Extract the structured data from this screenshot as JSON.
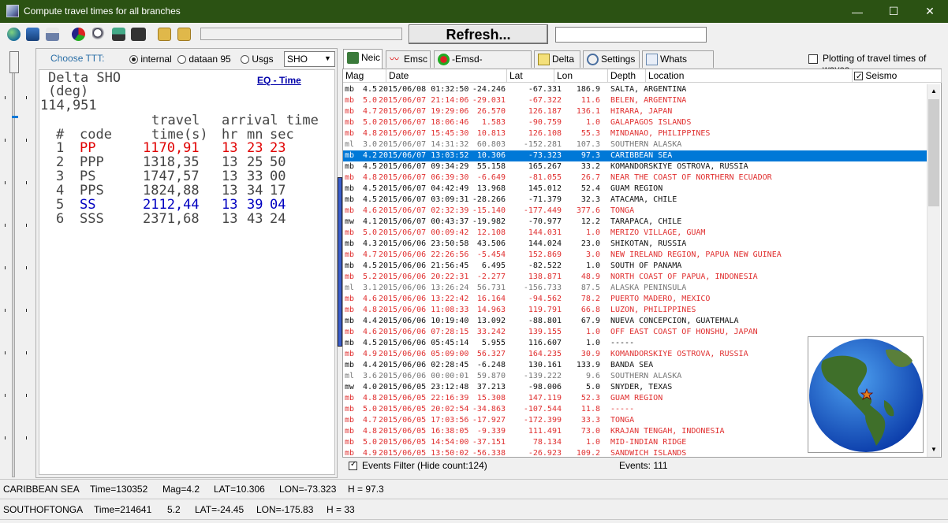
{
  "window": {
    "title": "Compute travel times for all branches",
    "min": "—",
    "max": "☐",
    "close": "✕"
  },
  "toolbar": {
    "refresh_label": "Refresh..."
  },
  "ttt_controls": {
    "choose_label": "Choose TTT:",
    "options": [
      "internal",
      "dataan 95",
      "Usgs"
    ],
    "selected": "internal",
    "station": "SHO"
  },
  "ttt": {
    "header1": "Delta SHO",
    "header2": "(deg)",
    "delta": "114,951",
    "eq_time_link": "EQ - Time",
    "col_travel": "travel",
    "col_arrival": "arrival time",
    "col_hash": "#",
    "col_code": "code",
    "col_time": "time(s)",
    "col_hr": "hr",
    "col_mn": "mn",
    "col_sec": "sec",
    "rows": [
      {
        "n": "1",
        "code": "PP",
        "time": "1170,91",
        "hr": "13",
        "mn": "23",
        "sec": "23",
        "color": "#e00000"
      },
      {
        "n": "2",
        "code": "PPP",
        "time": "1318,35",
        "hr": "13",
        "mn": "25",
        "sec": "50",
        "color": "#444444"
      },
      {
        "n": "3",
        "code": "PS",
        "time": "1747,57",
        "hr": "13",
        "mn": "33",
        "sec": "00",
        "color": "#444444"
      },
      {
        "n": "4",
        "code": "PPS",
        "time": "1824,88",
        "hr": "13",
        "mn": "34",
        "sec": "17",
        "color": "#444444"
      },
      {
        "n": "5",
        "code": "SS",
        "time": "2112,44",
        "hr": "13",
        "mn": "39",
        "sec": "04",
        "color": "#0000c0"
      },
      {
        "n": "6",
        "code": "SSS",
        "time": "2371,68",
        "hr": "13",
        "mn": "43",
        "sec": "24",
        "color": "#444444"
      }
    ]
  },
  "tabs": [
    "Neic",
    "Emsc",
    "-Emsd- Kamchatka",
    "Delta",
    "Settings",
    "Whats new..."
  ],
  "plot_option": "Plotting of travel times of waves",
  "columns": [
    "Mag",
    "Date",
    "Lat",
    "Lon",
    "Depth",
    "Location"
  ],
  "seismo_label": "Seismo",
  "events": [
    {
      "mt": "mb",
      "m": "4.5",
      "d": "2015/06/08 01:32:50",
      "lat": "-24.246",
      "lon": "-67.331",
      "dep": "186.9",
      "loc": "SALTA, ARGENTINA",
      "c": "black"
    },
    {
      "mt": "mb",
      "m": "5.0",
      "d": "2015/06/07 21:14:06",
      "lat": "-29.031",
      "lon": "-67.322",
      "dep": "11.6",
      "loc": "BELEN, ARGENTINA",
      "c": "red"
    },
    {
      "mt": "mb",
      "m": "4.7",
      "d": "2015/06/07 19:29:06",
      "lat": "26.570",
      "lon": "126.187",
      "dep": "136.1",
      "loc": "HIRARA, JAPAN",
      "c": "red"
    },
    {
      "mt": "mb",
      "m": "5.0",
      "d": "2015/06/07 18:06:46",
      "lat": "1.583",
      "lon": "-90.759",
      "dep": "1.0",
      "loc": "GALAPAGOS ISLANDS",
      "c": "red"
    },
    {
      "mt": "mb",
      "m": "4.8",
      "d": "2015/06/07 15:45:30",
      "lat": "10.813",
      "lon": "126.108",
      "dep": "55.3",
      "loc": "MINDANAO, PHILIPPINES",
      "c": "red"
    },
    {
      "mt": "ml",
      "m": "3.0",
      "d": "2015/06/07 14:31:32",
      "lat": "60.803",
      "lon": "-152.281",
      "dep": "107.3",
      "loc": "SOUTHERN ALASKA",
      "c": "gray"
    },
    {
      "mt": "mb",
      "m": "4.2",
      "d": "2015/06/07 13:03:52",
      "lat": "10.306",
      "lon": "-73.323",
      "dep": "97.3",
      "loc": "CARIBBEAN SEA",
      "c": "sel"
    },
    {
      "mt": "mb",
      "m": "4.5",
      "d": "2015/06/07 09:34:29",
      "lat": "55.158",
      "lon": "165.267",
      "dep": "33.2",
      "loc": "KOMANDORSKIYE OSTROVA, RUSSIA",
      "c": "black"
    },
    {
      "mt": "mb",
      "m": "4.8",
      "d": "2015/06/07 06:39:30",
      "lat": "-6.649",
      "lon": "-81.055",
      "dep": "26.7",
      "loc": "NEAR THE COAST OF NORTHERN ECUADOR",
      "c": "red"
    },
    {
      "mt": "mb",
      "m": "4.5",
      "d": "2015/06/07 04:42:49",
      "lat": "13.968",
      "lon": "145.012",
      "dep": "52.4",
      "loc": "GUAM REGION",
      "c": "black"
    },
    {
      "mt": "mb",
      "m": "4.5",
      "d": "2015/06/07 03:09:31",
      "lat": "-28.266",
      "lon": "-71.379",
      "dep": "32.3",
      "loc": "ATACAMA, CHILE",
      "c": "black"
    },
    {
      "mt": "mb",
      "m": "4.6",
      "d": "2015/06/07 02:32:39",
      "lat": "-15.140",
      "lon": "-177.449",
      "dep": "377.6",
      "loc": "TONGA",
      "c": "red"
    },
    {
      "mt": "mw",
      "m": "4.1",
      "d": "2015/06/07 00:43:37",
      "lat": "-19.982",
      "lon": "-70.977",
      "dep": "12.2",
      "loc": "TARAPACA, CHILE",
      "c": "black"
    },
    {
      "mt": "mb",
      "m": "5.0",
      "d": "2015/06/07 00:09:42",
      "lat": "12.108",
      "lon": "144.031",
      "dep": "1.0",
      "loc": "MERIZO VILLAGE, GUAM",
      "c": "red"
    },
    {
      "mt": "mb",
      "m": "4.3",
      "d": "2015/06/06 23:50:58",
      "lat": "43.506",
      "lon": "144.024",
      "dep": "23.0",
      "loc": "SHIKOTAN, RUSSIA",
      "c": "black"
    },
    {
      "mt": "mb",
      "m": "4.7",
      "d": "2015/06/06 22:26:56",
      "lat": "-5.454",
      "lon": "152.869",
      "dep": "3.0",
      "loc": "NEW IRELAND REGION, PAPUA NEW GUINEA",
      "c": "red"
    },
    {
      "mt": "mb",
      "m": "4.5",
      "d": "2015/06/06 21:56:45",
      "lat": "6.495",
      "lon": "-82.522",
      "dep": "1.0",
      "loc": "SOUTH OF PANAMA",
      "c": "black"
    },
    {
      "mt": "mb",
      "m": "5.2",
      "d": "2015/06/06 20:22:31",
      "lat": "-2.277",
      "lon": "138.871",
      "dep": "48.9",
      "loc": "NORTH COAST OF PAPUA, INDONESIA",
      "c": "red"
    },
    {
      "mt": "ml",
      "m": "3.1",
      "d": "2015/06/06 13:26:24",
      "lat": "56.731",
      "lon": "-156.733",
      "dep": "87.5",
      "loc": "ALASKA PENINSULA",
      "c": "gray"
    },
    {
      "mt": "mb",
      "m": "4.6",
      "d": "2015/06/06 13:22:42",
      "lat": "16.164",
      "lon": "-94.562",
      "dep": "78.2",
      "loc": "PUERTO MADERO, MEXICO",
      "c": "red"
    },
    {
      "mt": "mb",
      "m": "4.8",
      "d": "2015/06/06 11:08:33",
      "lat": "14.963",
      "lon": "119.791",
      "dep": "66.8",
      "loc": "LUZON, PHILIPPINES",
      "c": "red"
    },
    {
      "mt": "mb",
      "m": "4.4",
      "d": "2015/06/06 10:19:40",
      "lat": "13.092",
      "lon": "-88.801",
      "dep": "67.9",
      "loc": "NUEVA CONCEPCION, GUATEMALA",
      "c": "black"
    },
    {
      "mt": "mb",
      "m": "4.6",
      "d": "2015/06/06 07:28:15",
      "lat": "33.242",
      "lon": "139.155",
      "dep": "1.0",
      "loc": "OFF EAST COAST OF HONSHU, JAPAN",
      "c": "red"
    },
    {
      "mt": "mb",
      "m": "4.5",
      "d": "2015/06/06 05:45:14",
      "lat": "5.955",
      "lon": "116.607",
      "dep": "1.0",
      "loc": "-----",
      "c": "black"
    },
    {
      "mt": "mb",
      "m": "4.9",
      "d": "2015/06/06 05:09:00",
      "lat": "56.327",
      "lon": "164.235",
      "dep": "30.9",
      "loc": "KOMANDORSKIYE OSTROVA, RUSSIA",
      "c": "red"
    },
    {
      "mt": "mb",
      "m": "4.4",
      "d": "2015/06/06 02:28:45",
      "lat": "-6.248",
      "lon": "130.161",
      "dep": "133.9",
      "loc": "BANDA SEA",
      "c": "black"
    },
    {
      "mt": "ml",
      "m": "3.6",
      "d": "2015/06/06 00:00:01",
      "lat": "59.870",
      "lon": "-139.222",
      "dep": "9.6",
      "loc": "SOUTHERN ALASKA",
      "c": "gray"
    },
    {
      "mt": "mw",
      "m": "4.0",
      "d": "2015/06/05 23:12:48",
      "lat": "37.213",
      "lon": "-98.006",
      "dep": "5.0",
      "loc": "SNYDER, TEXAS",
      "c": "black"
    },
    {
      "mt": "mb",
      "m": "4.8",
      "d": "2015/06/05 22:16:39",
      "lat": "15.308",
      "lon": "147.119",
      "dep": "52.3",
      "loc": "GUAM REGION",
      "c": "red"
    },
    {
      "mt": "mb",
      "m": "5.0",
      "d": "2015/06/05 20:02:54",
      "lat": "-34.863",
      "lon": "-107.544",
      "dep": "11.8",
      "loc": "-----",
      "c": "red"
    },
    {
      "mt": "mb",
      "m": "4.7",
      "d": "2015/06/05 17:03:56",
      "lat": "-17.927",
      "lon": "-172.399",
      "dep": "33.3",
      "loc": "TONGA",
      "c": "red"
    },
    {
      "mt": "mb",
      "m": "4.8",
      "d": "2015/06/05 16:38:05",
      "lat": "-9.339",
      "lon": "111.491",
      "dep": "73.0",
      "loc": "KRAJAN TENGAH, INDONESIA",
      "c": "red"
    },
    {
      "mt": "mb",
      "m": "5.0",
      "d": "2015/06/05 14:54:00",
      "lat": "-37.151",
      "lon": "78.134",
      "dep": "1.0",
      "loc": "MID-INDIAN RIDGE",
      "c": "red"
    },
    {
      "mt": "mb",
      "m": "4.9",
      "d": "2015/06/05 13:50:02",
      "lat": "-56.338",
      "lon": "-26.923",
      "dep": "109.2",
      "loc": "SANDWICH ISLANDS",
      "c": "red"
    }
  ],
  "filter_label": "Events Filter (Hide count:124)",
  "events_count": "Events: 111",
  "status1": {
    "loc": "CARIBBEAN SEA",
    "time": "Time=130352",
    "mag": "Mag=4.2",
    "lat": "LAT=10.306",
    "lon": "LON=-73.323",
    "h": "H = 97.3"
  },
  "status2": {
    "loc": "SOUTHOFTONGA",
    "time": "Time=214641",
    "mag": "5.2",
    "lat": "LAT=-24.45",
    "lon": "LON=-175.83",
    "h": "H = 33"
  }
}
